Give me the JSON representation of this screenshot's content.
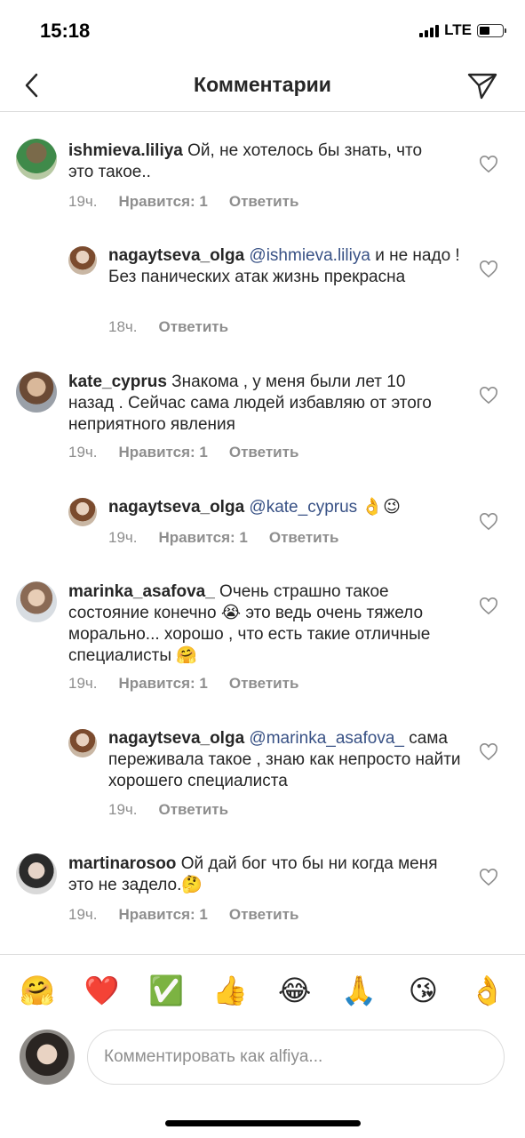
{
  "status": {
    "time": "15:18",
    "network": "LTE"
  },
  "header": {
    "title": "Комментарии"
  },
  "comments": [
    {
      "username": "ishmieva.liliya",
      "text": " Ой, не хотелось бы знать, что это такое..",
      "time": "19ч.",
      "likes": "Нравится: 1",
      "reply": "Ответить"
    },
    {
      "username": "nagaytseva_olga",
      "mention": "@ishmieva.liliya",
      "text": " и не надо ! Без панических атак жизнь прекрасна",
      "time": "18ч.",
      "reply": "Ответить"
    },
    {
      "username": "kate_cyprus",
      "text": " Знакома , у меня были лет 10 назад . Сейчас сама людей избавляю от этого неприятного явления",
      "time": "19ч.",
      "likes": "Нравится: 1",
      "reply": "Ответить"
    },
    {
      "username": "nagaytseva_olga",
      "mention": "@kate_cyprus",
      "text": " 👌😉",
      "time": "19ч.",
      "likes": "Нравится: 1",
      "reply": "Ответить"
    },
    {
      "username": "marinka_asafova_",
      "text": " Очень страшно такое состояние конечно 😭 это ведь  очень тяжело морально... хорошо , что есть такие отличные специалисты 🤗",
      "time": "19ч.",
      "likes": "Нравится: 1",
      "reply": "Ответить"
    },
    {
      "username": "nagaytseva_olga",
      "mention": "@marinka_asafova_",
      "text": " сама переживала такое , знаю как непросто найти хорошего специалиста",
      "time": "19ч.",
      "reply": "Ответить"
    },
    {
      "username": "martinarosoo",
      "text": " Ой дай бог что бы ни когда меня это не задело.🤔",
      "time": "19ч.",
      "likes": "Нравится: 1",
      "reply": "Ответить"
    }
  ],
  "emoji_bar": [
    "🤗",
    "❤️",
    "✅",
    "👍",
    "😂",
    "🙏",
    "😘",
    "👌"
  ],
  "input": {
    "placeholder": "Комментировать как alfiya..."
  },
  "colors": {
    "mention": "#385185",
    "secondary": "#8e8e8e",
    "text": "#262626",
    "border": "#dbdbdb"
  }
}
